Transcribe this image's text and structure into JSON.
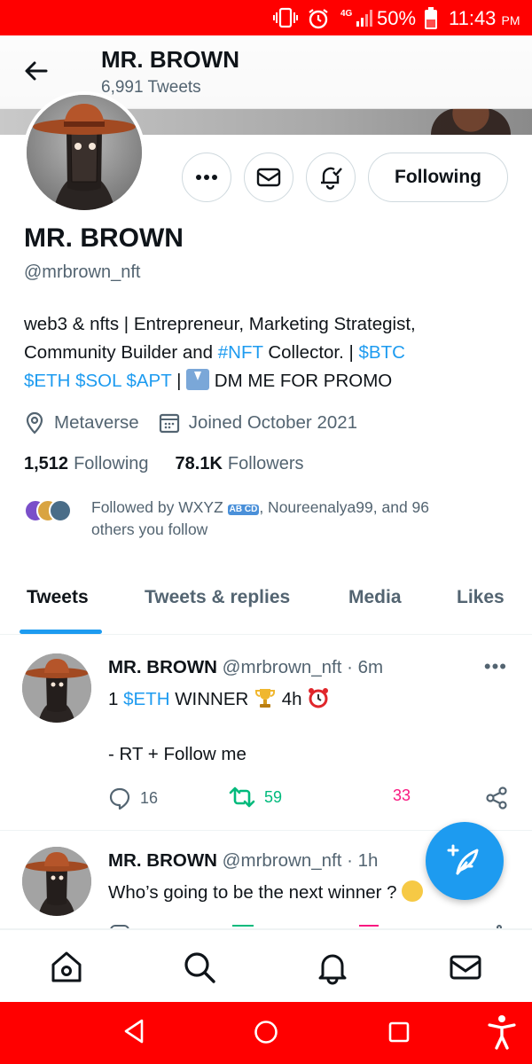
{
  "status_bar": {
    "network": "4G",
    "battery_pct": "50%",
    "time": "11:43",
    "time_suffix": "PM"
  },
  "header": {
    "name": "MR. BROWN",
    "tweet_count": "6,991 Tweets"
  },
  "actions": {
    "following_label": "Following"
  },
  "profile": {
    "name": "MR. BROWN",
    "handle": "@mrbrown_nft",
    "bio": {
      "line1": "web3 & nfts | Entrepreneur, Marketing Strategist,",
      "line2_prefix": "Community Builder and ",
      "hashtag": "#NFT",
      "line2_mid": " Collector. | ",
      "btc": "$BTC",
      "eth": "$ETH",
      "sol": "$SOL",
      "apt": "$APT",
      "sep": " | ",
      "dm_text": " DM ME FOR PROMO"
    },
    "location": "Metaverse",
    "joined": "Joined October 2021",
    "following_count": "1,512",
    "following_label": "Following",
    "followers_count": "78.1K",
    "followers_label": "Followers",
    "followed_by_prefix": "Followed by WXYZ ",
    "followed_by_badge": "AB CD",
    "followed_by_suffix": ", Noureenalya99, and 96",
    "followed_by_line2": "others you follow"
  },
  "tabs": [
    {
      "label": "Tweets",
      "active": true
    },
    {
      "label": "Tweets & replies",
      "active": false
    },
    {
      "label": "Media",
      "active": false
    },
    {
      "label": "Likes",
      "active": false
    }
  ],
  "tweets": [
    {
      "name": "MR. BROWN",
      "meta": " @mrbrown_nft · 6m",
      "line1_prefix": "1 ",
      "line1_link": "$ETH",
      "line1_mid": " WINNER ",
      "line1_time": " 4h ",
      "line2": "- RT + Follow me",
      "replies": "16",
      "retweets": "59",
      "likes": "33"
    },
    {
      "name": "MR. BROWN",
      "meta": " @mrbrown_nft · 1h",
      "line1": "Who’s going to be the next winner ?"
    }
  ],
  "icons": {
    "back": "arrow-left-icon",
    "more": "ellipsis-icon",
    "message": "envelope-icon",
    "notify": "bell-check-icon",
    "location": "location-pin-icon",
    "calendar": "calendar-icon",
    "reply": "reply-icon",
    "retweet": "retweet-icon",
    "like": "heart-icon",
    "share": "share-icon",
    "compose": "feather-plus-icon",
    "home": "home-icon",
    "search": "search-icon",
    "notifications": "bell-icon",
    "messages": "envelope-icon"
  },
  "colors": {
    "accent": "#1d9bf0",
    "retweet_green": "#00ba7c",
    "like_pink": "#f91880",
    "status_bar": "#ff0000"
  }
}
